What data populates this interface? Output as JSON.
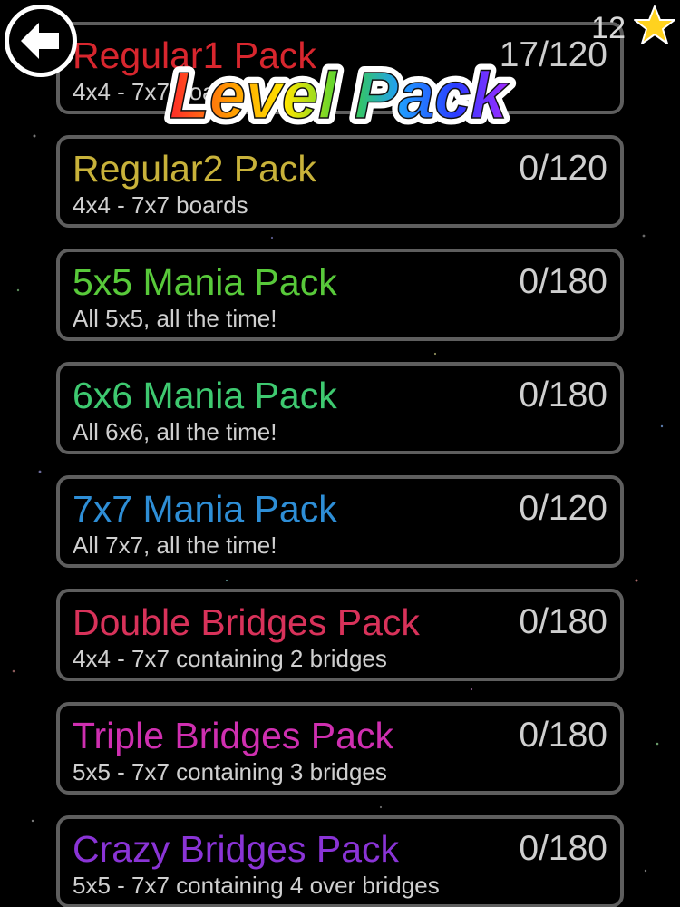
{
  "header": {
    "title": "Level Pack",
    "star_count": "12",
    "title_gradient": [
      "#ff2a2a",
      "#ff9a00",
      "#ffe600",
      "#3ad13a",
      "#1f9cff",
      "#2b3cff",
      "#a629ff"
    ]
  },
  "packs": [
    {
      "name": "Regular1 Pack",
      "desc": "4x4 - 7x7 boards",
      "progress": "17/120",
      "color": "#d8262e"
    },
    {
      "name": "Regular2 Pack",
      "desc": "4x4 - 7x7 boards",
      "progress": "0/120",
      "color": "#c8b23a"
    },
    {
      "name": "5x5 Mania Pack",
      "desc": "All 5x5, all the time!",
      "progress": "0/180",
      "color": "#58c93a"
    },
    {
      "name": "6x6 Mania Pack",
      "desc": "All 6x6, all the time!",
      "progress": "0/180",
      "color": "#3ec970"
    },
    {
      "name": "7x7 Mania Pack",
      "desc": "All 7x7, all the time!",
      "progress": "0/120",
      "color": "#2e8ed6"
    },
    {
      "name": "Double Bridges Pack",
      "desc": "4x4 - 7x7 containing 2 bridges",
      "progress": "0/180",
      "color": "#d8325a"
    },
    {
      "name": "Triple Bridges Pack",
      "desc": "5x5 - 7x7 containing 3 bridges",
      "progress": "0/180",
      "color": "#cf2fb0"
    },
    {
      "name": "Crazy Bridges Pack",
      "desc": "5x5 - 7x7 containing 4 over bridges",
      "progress": "0/180",
      "color": "#8a34d6"
    }
  ],
  "icons": {
    "back": "arrow-left-icon",
    "star": "star-icon"
  }
}
